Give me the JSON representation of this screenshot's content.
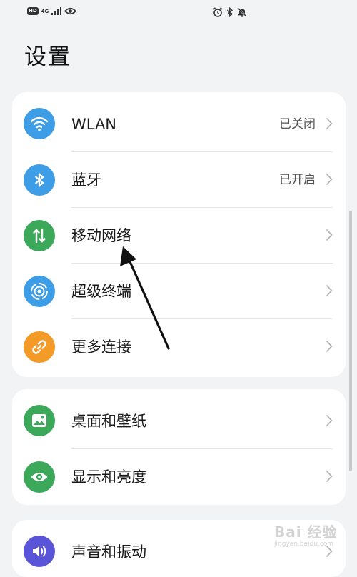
{
  "status_bar": {
    "hd": "HD",
    "network": "4G",
    "left_icons": [
      "signal-icon",
      "eye-icon"
    ],
    "right_icons": [
      "alarm-icon",
      "bluetooth-icon",
      "mute-icon"
    ]
  },
  "page": {
    "title": "设置"
  },
  "groups": [
    {
      "items": [
        {
          "label": "WLAN",
          "value": "已关闭",
          "icon": "wifi-icon",
          "color": "#3d9de6"
        },
        {
          "label": "蓝牙",
          "value": "已开启",
          "icon": "bluetooth-icon",
          "color": "#3d9de6"
        },
        {
          "label": "移动网络",
          "value": "",
          "icon": "mobile-data-icon",
          "color": "#3ba85a"
        },
        {
          "label": "超级终端",
          "value": "",
          "icon": "super-device-icon",
          "color": "#3d9de6"
        },
        {
          "label": "更多连接",
          "value": "",
          "icon": "link-icon",
          "color": "#f49a26"
        }
      ]
    },
    {
      "items": [
        {
          "label": "桌面和壁纸",
          "value": "",
          "icon": "wallpaper-icon",
          "color": "#3ba85a"
        },
        {
          "label": "显示和亮度",
          "value": "",
          "icon": "display-eye-icon",
          "color": "#3ba85a"
        }
      ]
    },
    {
      "items": [
        {
          "label": "声音和振动",
          "value": "",
          "icon": "sound-icon",
          "color": "#5a55d8"
        }
      ]
    }
  ],
  "annotation": {
    "icon": "arrow-icon",
    "points_to": "移动网络"
  },
  "watermark": {
    "text_top": "Bai 经验",
    "text_bottom": "jingyan.baidu.com"
  }
}
